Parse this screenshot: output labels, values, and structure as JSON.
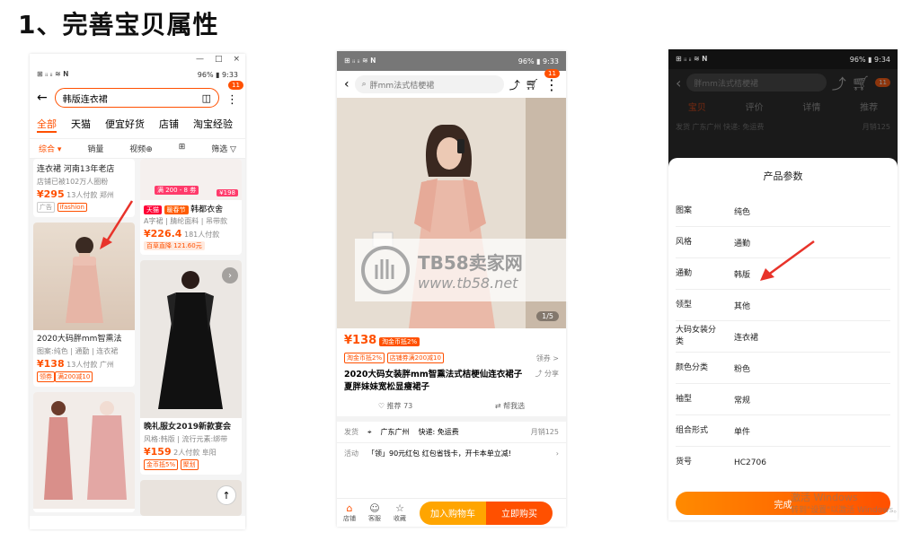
{
  "heading": "1、完善宝贝属性",
  "phone1": {
    "status_right": "96% ▮ 9:33",
    "status_left": "⊞ ᵢᵢ ᵢᵢ ≋ 𝐍",
    "search_text": "韩版连衣裙",
    "badge": "11",
    "tabs": [
      "全部",
      "天猫",
      "便宜好货",
      "店铺",
      "淘宝经验"
    ],
    "sort": [
      "综合 ▾",
      "销量",
      "视频⊕",
      "⊞",
      "筛选 ▽"
    ],
    "card1": {
      "title": "连衣裙 河南13年老店",
      "sub": "店铺已被102万人圈粉",
      "price": "¥295",
      "sold": "13人付款",
      "loc": "郑州",
      "tag": "广告",
      "shop": "ifashion"
    },
    "card2": {
      "banner": "满 200 - 8 劵",
      "sale": "¥198",
      "tags": [
        "天猫",
        "暖春节"
      ],
      "title": "韩都衣舍",
      "sub": "A字裙 | 腈纶面料 | 吊带款",
      "price": "¥226.4",
      "sold": "181人付款",
      "promo": "百草直降 121.60元"
    },
    "card3": {
      "title": "2020大码胖mm智熏法",
      "sub": "图案:纯色 | 通勤 | 连衣裙",
      "price": "¥138",
      "sold": "13人付款",
      "loc": "广州",
      "tag": "领券",
      "coupon": "满200减10"
    },
    "card4": {
      "title": "晚礼服女2019新款宴会",
      "sub": "风格:韩版 | 流行元素:绑带",
      "price": "¥159",
      "sold": "2人付款",
      "loc": "阜阳",
      "tag": "金币抵5%",
      "tag2": "聚划"
    }
  },
  "phone2": {
    "status_right": "96% ▮ 9:33",
    "status_left": "⊞ ᵢᵢ ᵢᵢ ≋ 𝐍",
    "search_text": "胖mm法式桔梗裙",
    "badge": "11",
    "img_count": "1/5",
    "price": "¥138",
    "price_tag": "淘金币抵2%",
    "coupons": [
      "淘金币抵2%",
      "店铺券满200减10"
    ],
    "coupon_action": "领券 >",
    "title": "2020大码女装胖mm智熏法式桔梗仙连衣裙子夏胖妹妹宽松显瘦裙子",
    "share": "分享",
    "recommend": "推荐 73",
    "help_choose": "帮我选",
    "ship_label": "发货",
    "ship_value": "广东广州",
    "ship_fee": "快递: 免运费",
    "monthly": "月销125",
    "activity_label": "活动",
    "activity_value": "「领」90元红包 红包省钱卡，开卡本单立减!",
    "bottom_icons": [
      "店铺",
      "客服",
      "收藏"
    ],
    "add_cart": "加入购物车",
    "buy_now": "立即购买"
  },
  "watermark": {
    "logo": "TB58卖家网",
    "url": "www.tb58.net"
  },
  "phone3": {
    "status_right": "96% ▮ 9:34",
    "status_left": "⊞ ᵢᵢ ᵢᵢ ≋ 𝐍",
    "search_text": "胖mm法式桔梗裙",
    "badge": "11",
    "tabs": [
      "宝贝",
      "评价",
      "详情",
      "推荐"
    ],
    "ship_label": "发货",
    "ship_value": "广东广州",
    "ship_fee": "快递: 免运费",
    "monthly": "月销125",
    "sheet_title": "产品参数",
    "params": [
      {
        "key": "图案",
        "value": "纯色"
      },
      {
        "key": "风格",
        "value": "通勤"
      },
      {
        "key": "通勤",
        "value": "韩版"
      },
      {
        "key": "领型",
        "value": "其他"
      },
      {
        "key": "大码女装分类",
        "value": "连衣裙"
      },
      {
        "key": "颜色分类",
        "value": "粉色"
      },
      {
        "key": "袖型",
        "value": "常规"
      },
      {
        "key": "组合形式",
        "value": "单件"
      },
      {
        "key": "货号",
        "value": "HC2706"
      }
    ],
    "done": "完成"
  },
  "win_activation": {
    "line1": "激活 Windows",
    "line2": "转到\"设置\"以激活 Windows。"
  },
  "colors": {
    "accent": "#ff5000",
    "cart": "#ffa500",
    "arrow": "#e8332a"
  }
}
